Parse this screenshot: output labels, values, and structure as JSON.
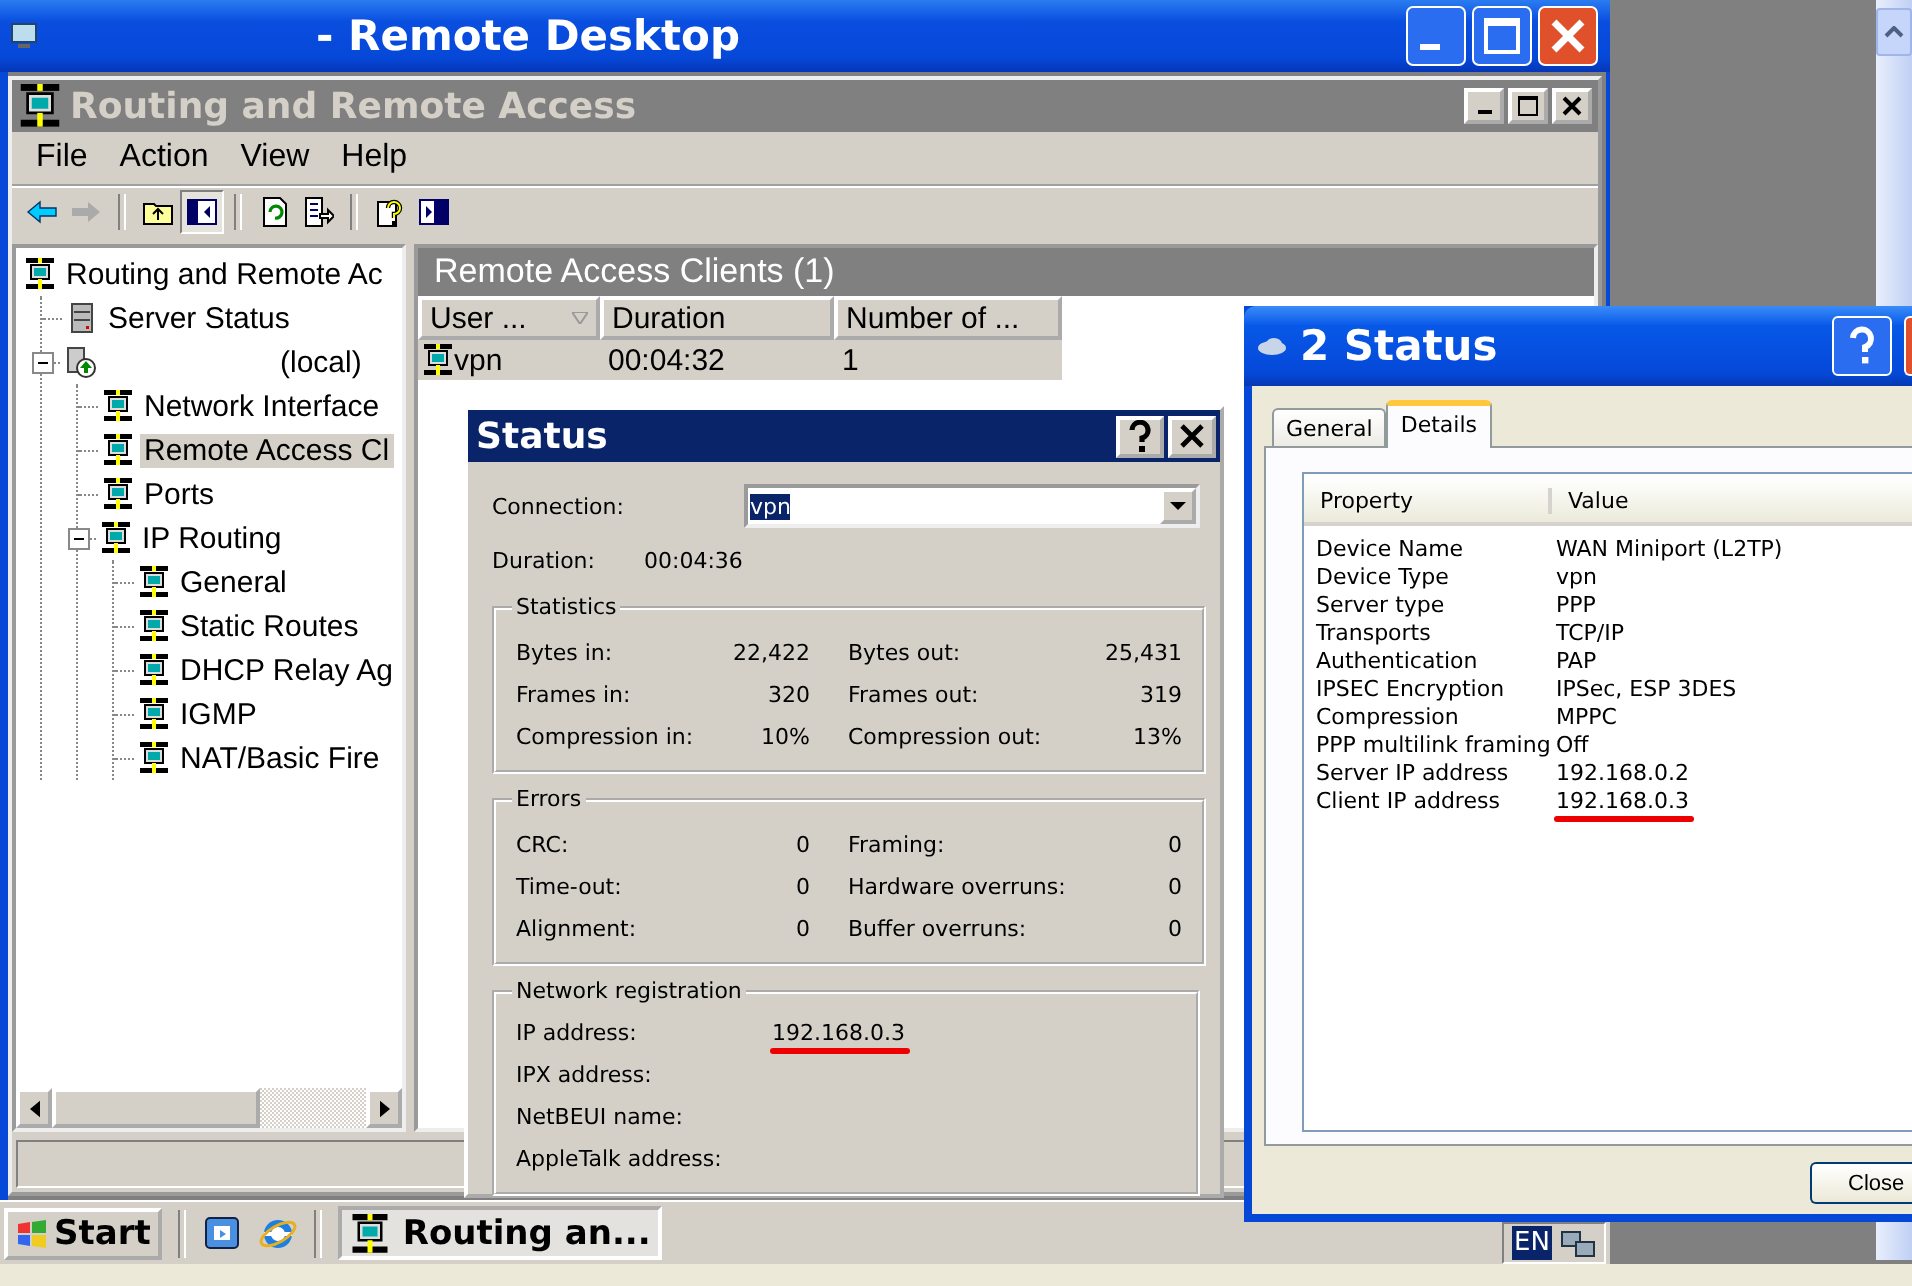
{
  "remote_desktop": {
    "title": "- Remote Desktop"
  },
  "mmc": {
    "title": "Routing and Remote Access",
    "menu": [
      {
        "label": "File"
      },
      {
        "label": "Action"
      },
      {
        "label": "View"
      },
      {
        "label": "Help"
      }
    ],
    "toolbar": [
      {
        "buttons": [
          {
            "kind": "back",
            "pressed": false
          },
          {
            "kind": "forward",
            "pressed": false
          }
        ]
      },
      {
        "buttons": [
          {
            "kind": "up",
            "pressed": false
          },
          {
            "kind": "tree",
            "pressed": true
          }
        ]
      },
      {
        "buttons": [
          {
            "kind": "refresh",
            "pressed": false
          },
          {
            "kind": "export",
            "pressed": false
          }
        ]
      },
      {
        "buttons": [
          {
            "kind": "help",
            "pressed": false
          },
          {
            "kind": "panel",
            "pressed": false
          }
        ]
      }
    ],
    "tree": [
      {
        "label": "Routing and Remote Ac",
        "kind": "network",
        "selected": false,
        "children": [
          {
            "label": "Server Status",
            "kind": "server",
            "selected": false
          },
          {
            "label": "(local)",
            "kind": "local",
            "selected": false,
            "expanded": true,
            "children": [
              {
                "label": "Network Interface",
                "kind": "network",
                "selected": false
              },
              {
                "label": "Remote Access Cl",
                "kind": "network",
                "selected": true
              },
              {
                "label": "Ports",
                "kind": "network",
                "selected": false
              },
              {
                "label": "IP Routing",
                "kind": "network",
                "selected": false,
                "expanded": true,
                "children": [
                  {
                    "label": "General",
                    "kind": "network",
                    "selected": false
                  },
                  {
                    "label": "Static Routes",
                    "kind": "network",
                    "selected": false
                  },
                  {
                    "label": "DHCP Relay Ag",
                    "kind": "network",
                    "selected": false
                  },
                  {
                    "label": "IGMP",
                    "kind": "network",
                    "selected": false
                  },
                  {
                    "label": "NAT/Basic Fire",
                    "kind": "network",
                    "selected": false
                  }
                ]
              }
            ]
          }
        ]
      }
    ],
    "pane": {
      "title": "Remote Access Clients (1)",
      "columns": [
        "User ...",
        "Duration",
        "Number of ..."
      ],
      "rows": [
        {
          "cells": [
            "vpn",
            "00:04:32",
            "1"
          ],
          "selected": true
        }
      ]
    }
  },
  "status_dialog": {
    "title": "Status",
    "connection": {
      "label": "Connection:",
      "value": "vpn"
    },
    "duration": {
      "label": "Duration:",
      "value": "00:04:36"
    },
    "groups": [
      {
        "title": "Statistics",
        "rows": [
          {
            "left_label": "Bytes in:",
            "left_value": "22,422",
            "right_label": "Bytes out:",
            "right_value": "25,431"
          },
          {
            "left_label": "Frames in:",
            "left_value": "320",
            "right_label": "Frames out:",
            "right_value": "319"
          },
          {
            "left_label": "Compression in:",
            "left_value": "10%",
            "right_label": "Compression out:",
            "right_value": "13%"
          }
        ]
      },
      {
        "title": "Errors",
        "rows": [
          {
            "left_label": "CRC:",
            "left_value": "0",
            "right_label": "Framing:",
            "right_value": "0"
          },
          {
            "left_label": "Time-out:",
            "left_value": "0",
            "right_label": "Hardware overruns:",
            "right_value": "0"
          },
          {
            "left_label": "Alignment:",
            "left_value": "0",
            "right_label": "Buffer overruns:",
            "right_value": "0"
          }
        ]
      }
    ],
    "registration": {
      "title": "Network registration",
      "rows": [
        {
          "label": "IP address:",
          "value": "192.168.0.3",
          "highlighted": true
        },
        {
          "label": "IPX address:"
        },
        {
          "label": "NetBEUI name:"
        },
        {
          "label": "AppleTalk address:"
        }
      ]
    }
  },
  "details_dialog": {
    "title": "2 Status",
    "tabs": [
      {
        "label": "General",
        "selected": false
      },
      {
        "label": "Details",
        "selected": true
      }
    ],
    "columns": [
      "Property",
      "Value"
    ],
    "rows": [
      {
        "property": "Device Name",
        "value": "WAN Miniport (L2TP)",
        "highlighted": false
      },
      {
        "property": "Device Type",
        "value": "vpn",
        "highlighted": false
      },
      {
        "property": "Server type",
        "value": "PPP",
        "highlighted": false
      },
      {
        "property": "Transports",
        "value": "TCP/IP",
        "highlighted": false
      },
      {
        "property": "Authentication",
        "value": "PAP",
        "highlighted": false
      },
      {
        "property": "IPSEC Encryption",
        "value": "IPSec, ESP 3DES",
        "highlighted": false
      },
      {
        "property": "Compression",
        "value": "MPPC",
        "highlighted": false
      },
      {
        "property": "PPP multilink framing",
        "value": "Off",
        "highlighted": false
      },
      {
        "property": "Server IP address",
        "value": "192.168.0.2",
        "highlighted": false
      },
      {
        "property": "Client IP address",
        "value": "192.168.0.3",
        "highlighted": true
      }
    ],
    "close_button": "Close"
  },
  "taskbar": {
    "start": "Start",
    "tasks": [
      {
        "label": "Routing an...",
        "selected": true
      }
    ],
    "language": "EN"
  }
}
